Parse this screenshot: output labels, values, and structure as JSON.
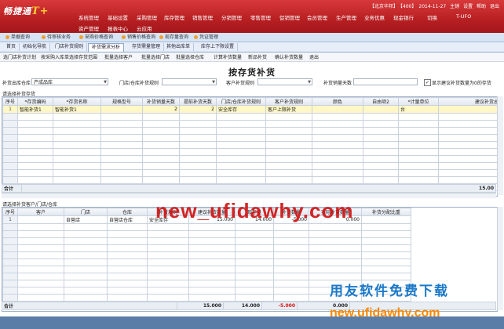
{
  "brand": {
    "logo_text": "畅捷通",
    "logo_suffix": "T+"
  },
  "top_menu_row1": [
    "系统管理",
    "基础设置",
    "采购管理",
    "库存管理",
    "销售管理",
    "分销管理",
    "零售管理",
    "促销管理",
    "会员管理",
    "生产管理",
    "业务优惠",
    "现金银行",
    "切换",
    "T-UFO"
  ],
  "top_menu_row2": [
    "资产管理",
    "报表中心",
    "云应用"
  ],
  "top_info": {
    "account": "【北京华邦】",
    "acct_no": "【400】",
    "date": "2014-11-27",
    "user": "主销",
    "settings": "设置",
    "help": "帮助",
    "exit": "退出"
  },
  "doc_tabs": [
    "单据查询",
    "待审核业务",
    "采购价格查询",
    "销售价格查询",
    "现存量查询",
    "凭证管理"
  ],
  "page_tabs": [
    "首页",
    "初始化导航",
    "门店补货规则",
    "补货需求分析",
    "存货需量管理",
    "其他出库单",
    "库存上下限设置"
  ],
  "toolbar": [
    "选门店补货计划",
    "按采购入库单选择存货范围",
    "批量选择客户",
    "批量选择门店",
    "批量选择仓库",
    "计算补货数量",
    "新品补货",
    "确认补货数量",
    "退出"
  ],
  "page_title": "按存货补货",
  "filters": {
    "warehouse_label": "补货出库仓库",
    "warehouse_value": "产成品库",
    "store_label": "门店/仓库补货规则",
    "store_value": "",
    "customer_label": "客户补货规则",
    "customer_value": "",
    "days_label": "补货销量天数",
    "days_value": "",
    "checkbox_label": "显示建议补货数量为0的存货"
  },
  "top_grid": {
    "section_label": "请选择补货存货",
    "columns": [
      "序号",
      "*存货编码",
      "*存货名称",
      "规格型号",
      "补货销量天数",
      "提前补货天数",
      "门店/仓库补货规则",
      "客户补货规则",
      "颜色",
      "自由项2",
      "*计量单位",
      "建议补货总数量"
    ],
    "rows": [
      [
        "1",
        "智能补货1",
        "智能补货1",
        "",
        "2",
        "2",
        "安全库存",
        "客户上限补货",
        "",
        "",
        "台",
        "15.0"
      ]
    ],
    "total_label": "合计",
    "total_value": "15.00"
  },
  "bottom_grid": {
    "section_label": "请选择补货客户/门店/仓库",
    "columns": [
      "序号",
      "客户",
      "门店",
      "仓库",
      "补货规则",
      "建议补货数量",
      "现存量",
      "补货数量",
      "实际补货数量",
      "补货分配比重"
    ],
    "rows": [
      [
        "1",
        "",
        "自营店",
        "自营店仓库",
        "安全库存",
        "15.000",
        "14.000",
        "-5.000",
        "0.000",
        ""
      ]
    ],
    "total_label": "合计",
    "totals": [
      "15.000",
      "14.000",
      "-5.000",
      "0.000"
    ]
  },
  "watermark": {
    "url_main": "new_ufidawhy.com",
    "cn": "用友软件免费下载",
    "url_small": "new.ufidawhy.com"
  },
  "colors": {
    "banner": "#b71f22",
    "selected_row": "#fff7c6",
    "wm_red": "#d11414",
    "wm_blue": "#1a78c8",
    "wm_orange": "#ff8800"
  }
}
